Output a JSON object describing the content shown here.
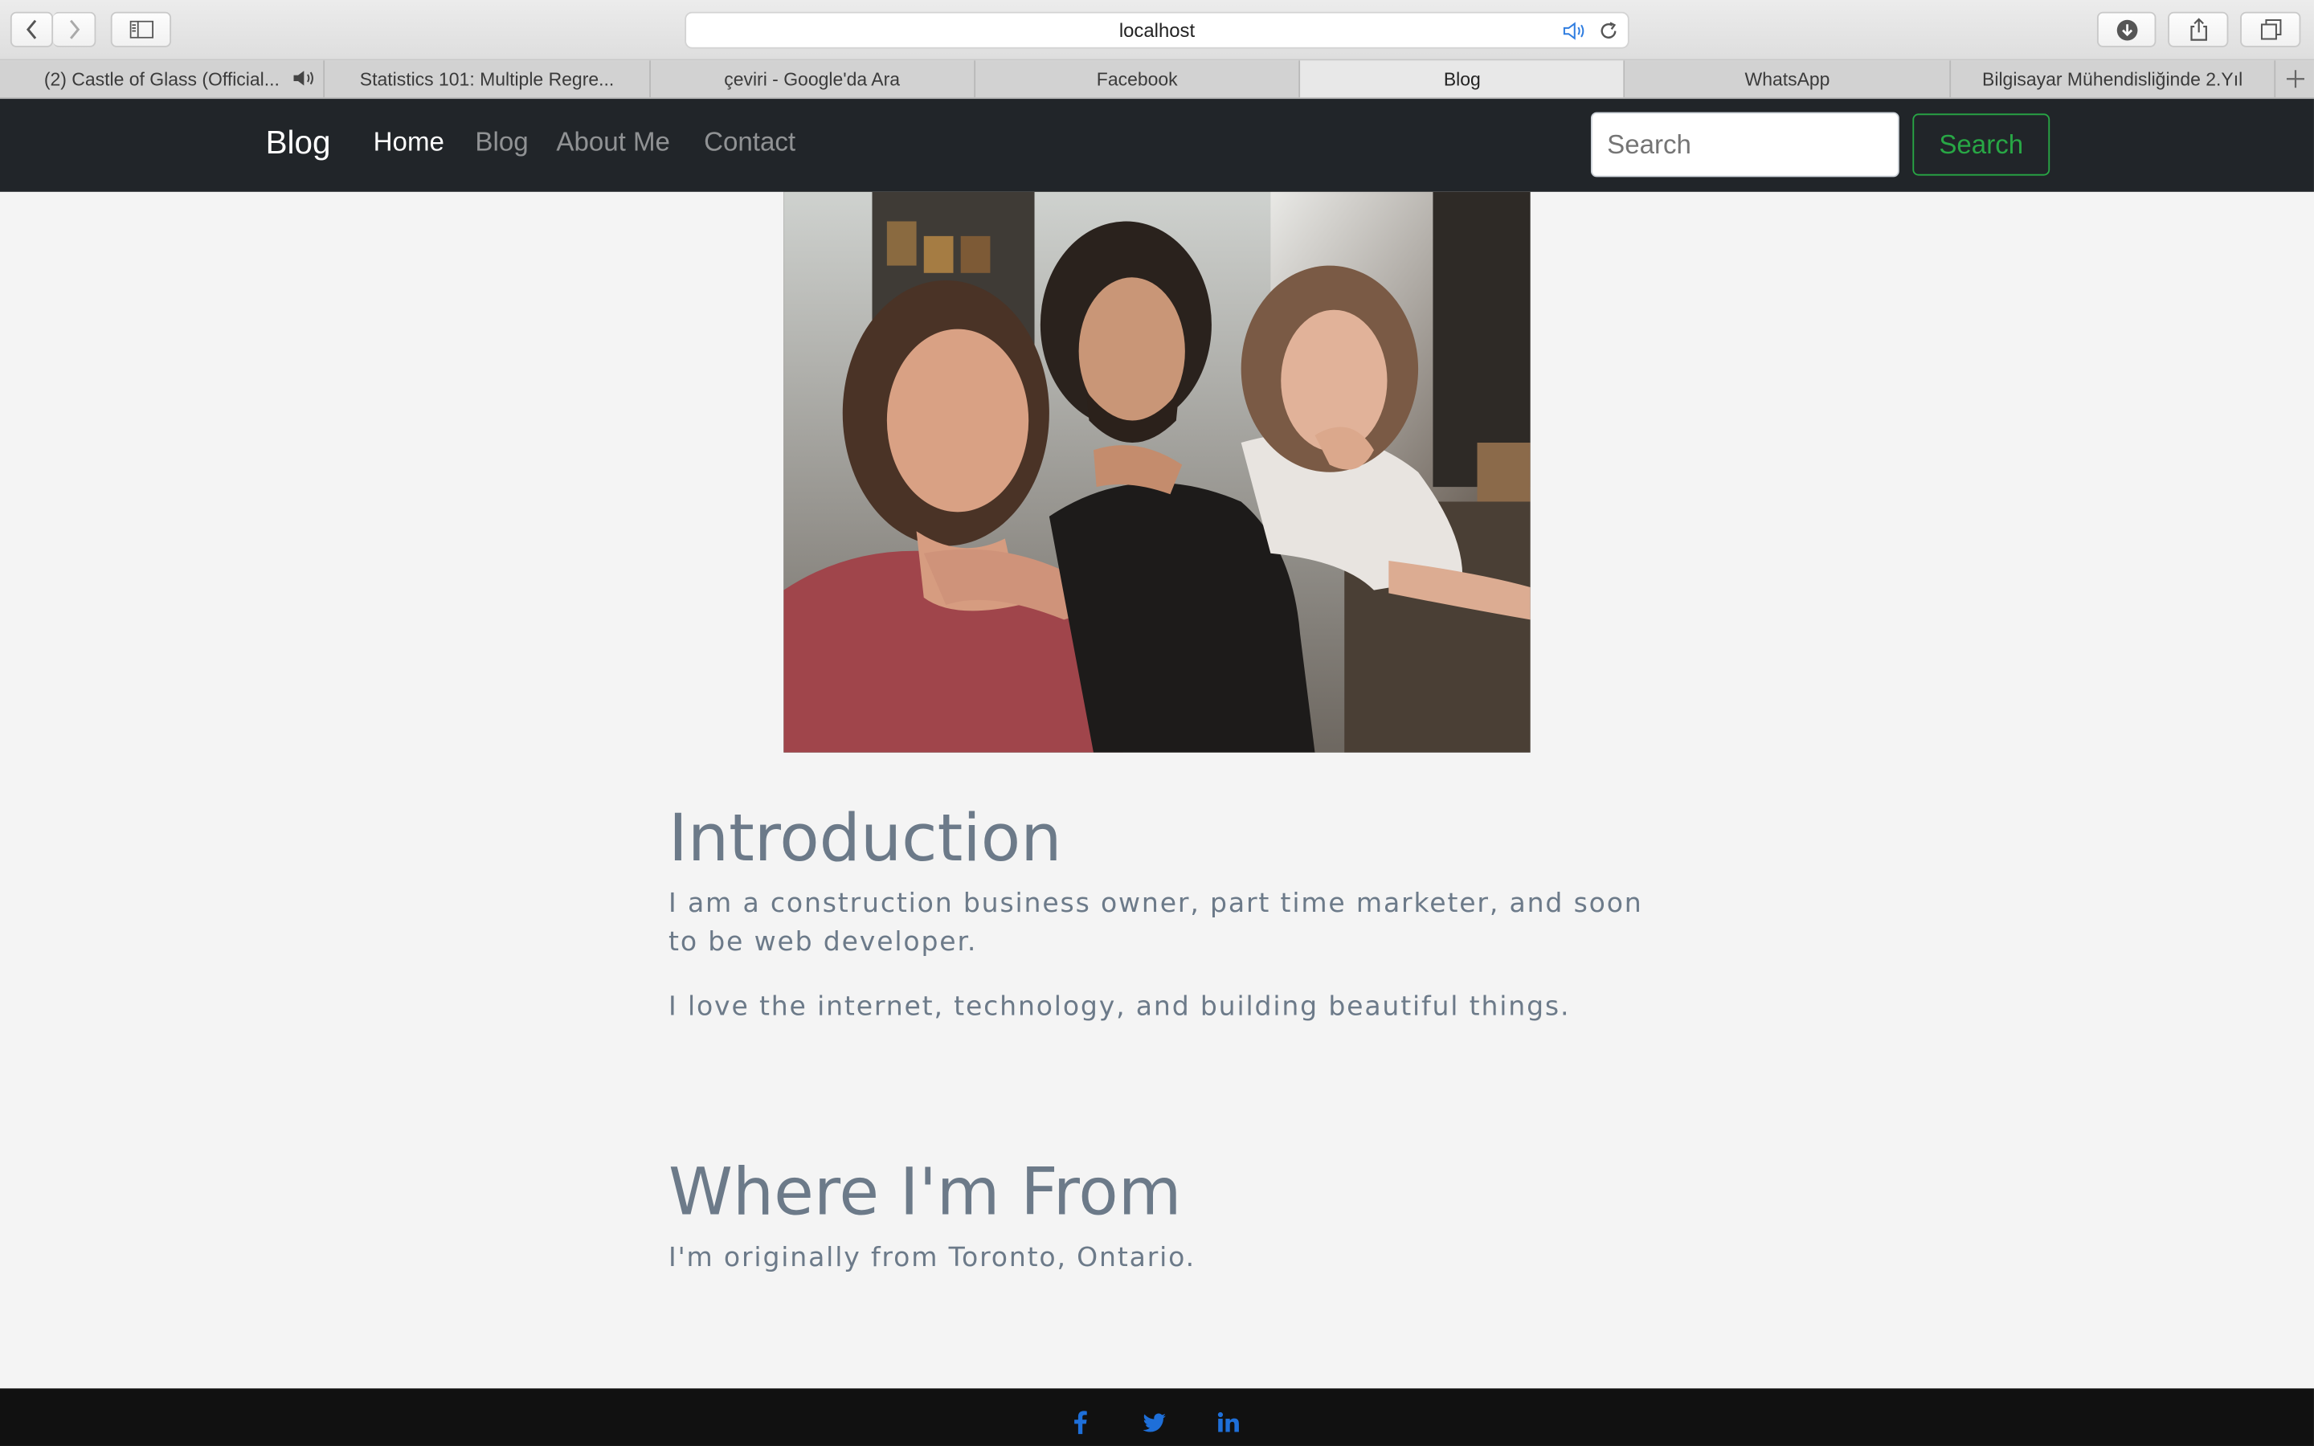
{
  "browser": {
    "url": "localhost",
    "tabs": [
      {
        "label": "(2) Castle of Glass (Official...",
        "active": false,
        "audio": true
      },
      {
        "label": "Statistics 101: Multiple Regre...",
        "active": false
      },
      {
        "label": "çeviri - Google'da Ara",
        "active": false
      },
      {
        "label": "Facebook",
        "active": false
      },
      {
        "label": "Blog",
        "active": true
      },
      {
        "label": "WhatsApp",
        "active": false
      },
      {
        "label": "Bilgisayar Mühendisliğinde 2.Yıl",
        "active": false
      }
    ]
  },
  "navbar": {
    "brand": "Blog",
    "links": [
      "Home",
      "Blog",
      "About Me",
      "Contact"
    ],
    "search_placeholder": "Search",
    "search_button": "Search"
  },
  "content": {
    "intro_title": "Introduction",
    "intro_p1": "I am a construction business owner, part time marketer, and soon to be web developer.",
    "intro_p2": "I love the internet, technology, and building beautiful things.",
    "from_title": "Where I'm From",
    "from_p1": "I'm originally from Toronto, Ontario."
  },
  "footer": {
    "icons": [
      "facebook-icon",
      "twitter-icon",
      "linkedin-icon"
    ]
  },
  "colors": {
    "navbar_bg": "#212529",
    "accent_green": "#28a745",
    "text_muted": "#6c7a89",
    "footer_bg": "#111111",
    "social_blue": "#1e6fd9"
  }
}
